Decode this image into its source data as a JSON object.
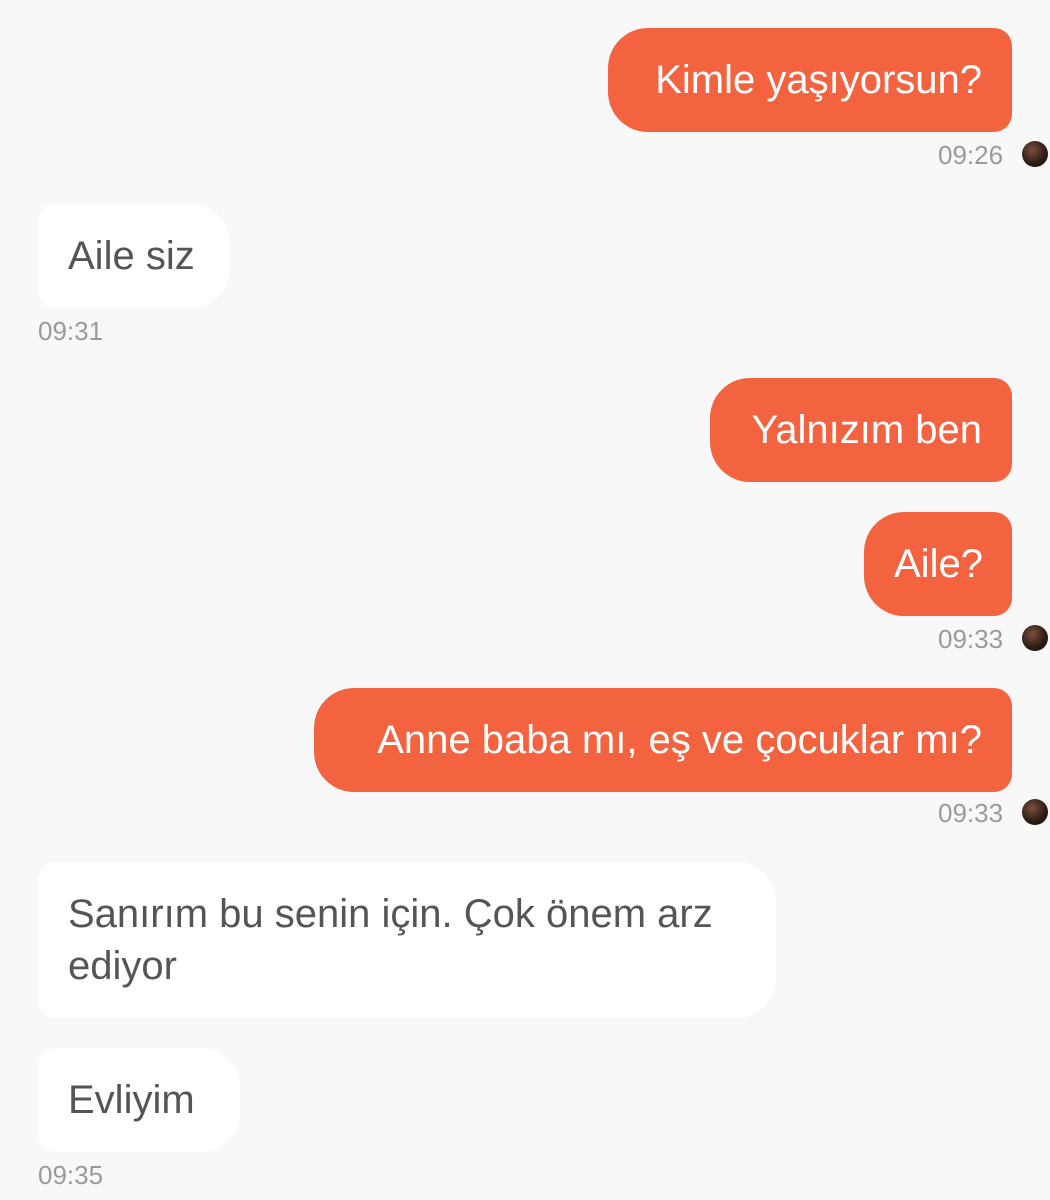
{
  "messages": [
    {
      "direction": "outgoing",
      "text": "Kimle yaşıyorsun?",
      "time": "09:26"
    },
    {
      "direction": "incoming",
      "text": "Aile siz",
      "time": "09:31"
    },
    {
      "direction": "outgoing",
      "text": "Yalnızım ben",
      "time": ""
    },
    {
      "direction": "outgoing",
      "text": "Aile?",
      "time": "09:33"
    },
    {
      "direction": "outgoing",
      "text": "Anne baba mı, eş ve çocuklar mı?",
      "time": "09:33"
    },
    {
      "direction": "incoming",
      "text": "Sanırım bu senin için. Çok önem arz ediyor",
      "time": ""
    },
    {
      "direction": "incoming",
      "text": "Evliyim",
      "time": "09:35"
    }
  ],
  "colors": {
    "outgoing_bubble": "#f4633f",
    "incoming_bubble": "#ffffff",
    "background": "#f8f8f8",
    "timestamp": "#9a9a9a"
  },
  "icons": {
    "read_receipt": "sender-avatar-icon"
  }
}
